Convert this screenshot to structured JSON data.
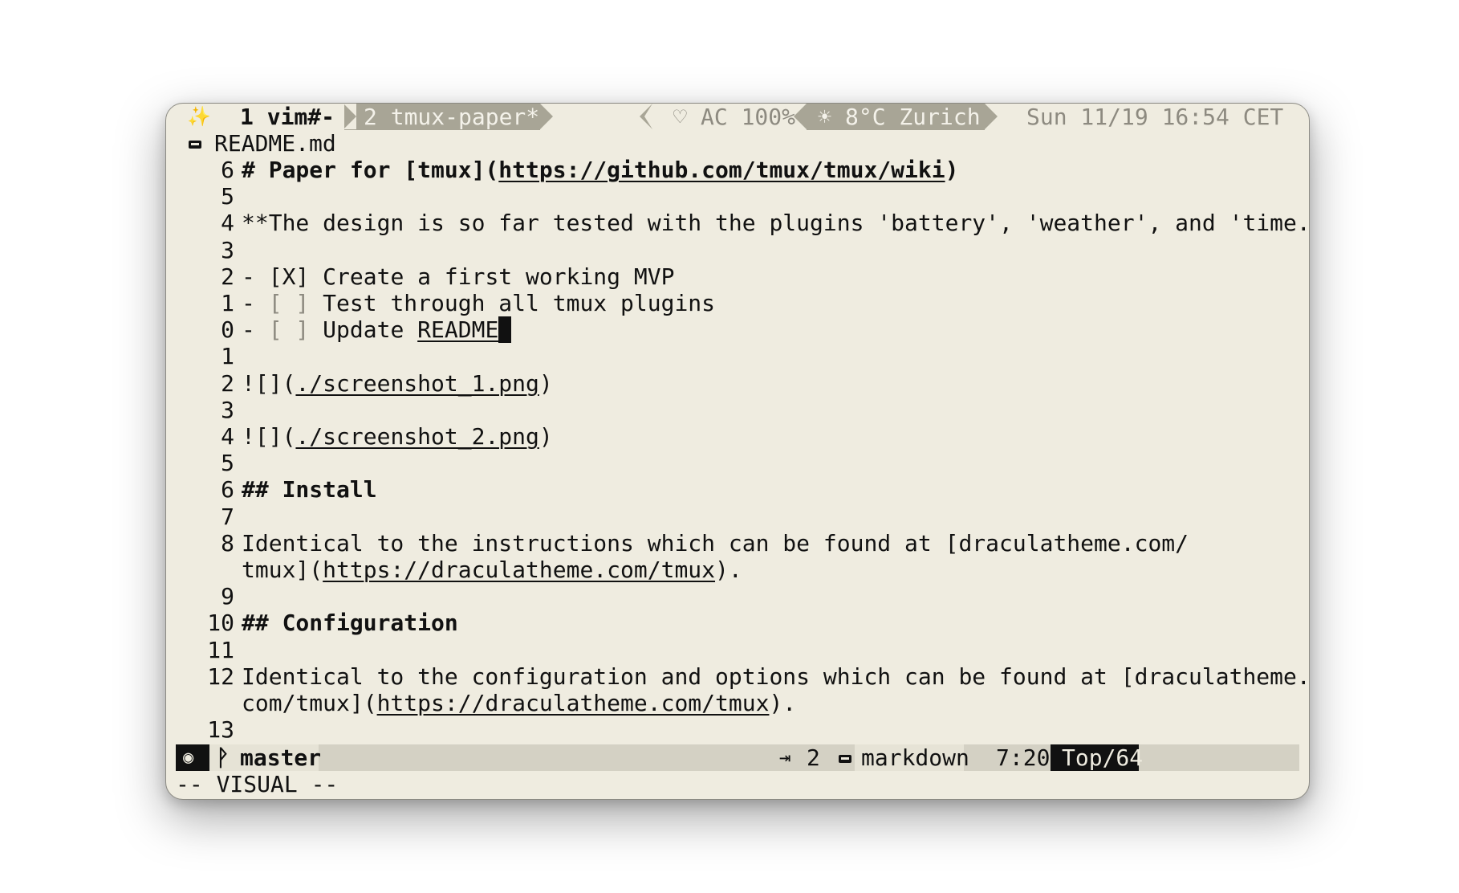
{
  "tmux": {
    "spark_icon": "✨",
    "window1": "1 vim#-",
    "window2": "2 tmux-paper*",
    "battery_icon": "♡",
    "battery": "AC 100%",
    "weather_icon": "☀",
    "weather": "8°C Zurich",
    "time": "Sun 11/19 16:54 CET"
  },
  "buffer": {
    "filename": "README.md"
  },
  "lines": [
    {
      "num": "6",
      "pre": "# Paper for [tmux](",
      "link": "https://github.com/tmux/tmux/wiki",
      "post": ")"
    },
    {
      "num": "5"
    },
    {
      "num": "4",
      "text": "**The design is so far tested with the plugins 'battery', 'weather', and 'time.**"
    },
    {
      "num": "3"
    },
    {
      "num": "2",
      "pre": "- [X] ",
      "text": "Create a first working MVP"
    },
    {
      "num": "1",
      "pre": "- ",
      "box": "[ ]",
      "text": " Test through all tmux plugins"
    },
    {
      "num": "0",
      "pre": "- ",
      "box": "[ ]",
      "text": " Update ",
      "link": "README"
    },
    {
      "num": "1"
    },
    {
      "num": "2",
      "pre": "![](",
      "link": "./screenshot_1.png",
      "post": ")"
    },
    {
      "num": "3"
    },
    {
      "num": "4",
      "pre": "![](",
      "link": "./screenshot_2.png",
      "post": ")"
    },
    {
      "num": "5"
    },
    {
      "num": "6",
      "text": "## Install"
    },
    {
      "num": "7"
    },
    {
      "num": "8",
      "text": "Identical to the instructions which can be found at [draculatheme.com/"
    },
    {
      "num": "",
      "pre": "tmux](",
      "link": "https://draculatheme.com/tmux",
      "post": ")."
    },
    {
      "num": "9"
    },
    {
      "num": "10",
      "text": "## Configuration"
    },
    {
      "num": "11"
    },
    {
      "num": "12",
      "text": "Identical to the configuration and options which can be found at [draculatheme."
    },
    {
      "num": "",
      "pre": "com/tmux](",
      "link": "https://draculatheme.com/tmux",
      "post": ")."
    },
    {
      "num": "13"
    }
  ],
  "statusline": {
    "mode_icon": "◉",
    "branch_icon": "ᚹ",
    "branch": "master",
    "indent_icon": "⇥",
    "indent": "2",
    "filetype": "markdown",
    "position": "7:20",
    "scroll": "Top/64"
  },
  "mode": "-- VISUAL --"
}
